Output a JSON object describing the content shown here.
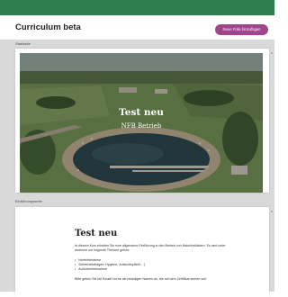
{
  "header": {
    "title": "Curriculum beta",
    "add_button_label": "Neue Folie hinzufügen"
  },
  "sections": {
    "header_label": "Startseite",
    "page_label": "Einführungsseite"
  },
  "hero": {
    "title": "Test neu",
    "subtitle": "NFB Betrieb"
  },
  "page": {
    "heading": "Test neu",
    "intro": "In diesem Kurs erhalten Sie eine allgemeine Einführung in den Betrieb von Naturfreibädern. Es wird unter anderem um folgende Themen gehen:",
    "list": [
      "Inbetriebnahme",
      "Sicherheitsfragen: Hygiene, Aufsichtspflicht ...)",
      "Außerbetriebnahme"
    ],
    "outro": "Bitte geben Sie bei Bedarf vorne die jeweiligen Namen an, die auf dem Zertifikat stehen soll."
  },
  "colors": {
    "accent": "#a0458d",
    "top_strip": "#2e7d4f",
    "background": "#d9d9d9"
  }
}
